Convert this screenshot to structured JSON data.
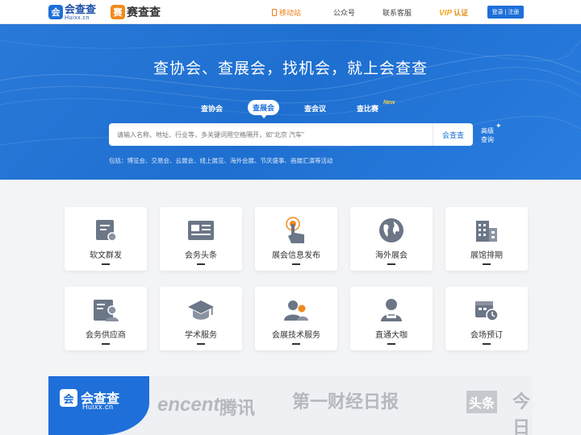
{
  "header": {
    "logo_primary": {
      "mark": "会",
      "name": "会查查",
      "domain": "Huixx.cn"
    },
    "logo_secondary": {
      "mark": "赛",
      "name": "赛查查"
    },
    "nav": {
      "mobile": "移动站",
      "wechat": "公众号",
      "service": "联系客服",
      "vip": "VIP",
      "vip_suffix": "认证",
      "login": "登录",
      "register": "注册",
      "login_sep": "|"
    }
  },
  "hero": {
    "slogan": "查协会、查展会，找机会，就上会查查",
    "tabs": [
      {
        "label": "查协会",
        "active": false
      },
      {
        "label": "查展会",
        "active": true
      },
      {
        "label": "查会议",
        "active": false
      },
      {
        "label": "查比赛",
        "active": false
      }
    ],
    "new_badge": "New",
    "search": {
      "placeholder": "请输入名称、地址、行业等，多关键词用空格隔开，如\"北京 汽车\"",
      "button": "会查查"
    },
    "advanced": {
      "line1": "高级",
      "line2": "查询"
    },
    "includes": "包括：博览会、交易会、云展会、线上展览、海外会展、节庆盛事、画展汇演等活动"
  },
  "services": {
    "row1": [
      {
        "label": "软文群发",
        "icon": "document-send-icon"
      },
      {
        "label": "会务头条",
        "icon": "newspaper-icon"
      },
      {
        "label": "展会信息发布",
        "icon": "tap-icon"
      },
      {
        "label": "海外展会",
        "icon": "globe-icon"
      },
      {
        "label": "展馆排期",
        "icon": "building-icon"
      }
    ],
    "row2": [
      {
        "label": "会务供应商",
        "icon": "id-card-icon"
      },
      {
        "label": "学术服务",
        "icon": "graduation-cap-icon"
      },
      {
        "label": "会展技术服务",
        "icon": "user-group-icon"
      },
      {
        "label": "直通大咖",
        "icon": "vip-person-icon"
      },
      {
        "label": "会场预订",
        "icon": "calendar-clock-icon"
      }
    ]
  },
  "partners": {
    "logo": {
      "mark": "会",
      "name": "会查查",
      "domain": "Huixx.cn"
    },
    "items": [
      "encent",
      "腾讯",
      "第一财经日报",
      "头条",
      "今日"
    ]
  },
  "colors": {
    "primary": "#1e6fd9",
    "accent": "#f07a12",
    "vip": "#f5a623",
    "icon": "#6b7686"
  }
}
